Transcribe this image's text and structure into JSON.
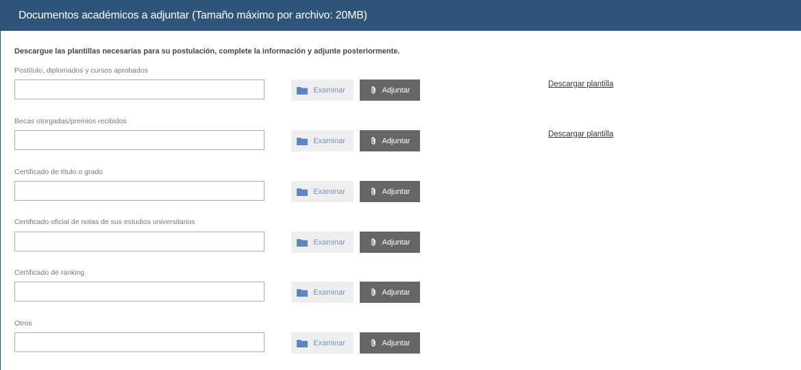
{
  "header": {
    "title": "Documentos académicos a adjuntar (Tamaño máximo por archivo: 20MB)"
  },
  "instructions": "Descargue las plantillas necesarias para su postulación, complete la información y adjunte posteriormente.",
  "buttons": {
    "browse_label": "Examinar",
    "attach_label": "Adjuntar",
    "browse_icon": "folder-icon",
    "attach_icon": "paperclip-icon"
  },
  "documents": [
    {
      "label": "Postítulo, diplomados y cursos aprobados",
      "value": "",
      "template_link": "Descargar plantilla"
    },
    {
      "label": "Becas otorgadas/premios recibidos",
      "value": "",
      "template_link": "Descargar plantilla"
    },
    {
      "label": "Certificado de título o grado",
      "value": ""
    },
    {
      "label": "Certificado oficial de notas de sus estudios universitarios",
      "value": ""
    },
    {
      "label": "Certificado de ranking",
      "value": ""
    },
    {
      "label": "Otros",
      "value": ""
    }
  ],
  "colors": {
    "header_bg": "#2c5579",
    "browse_bg": "#eeeeee",
    "browse_text": "#6f95c2",
    "attach_bg": "#666666"
  }
}
